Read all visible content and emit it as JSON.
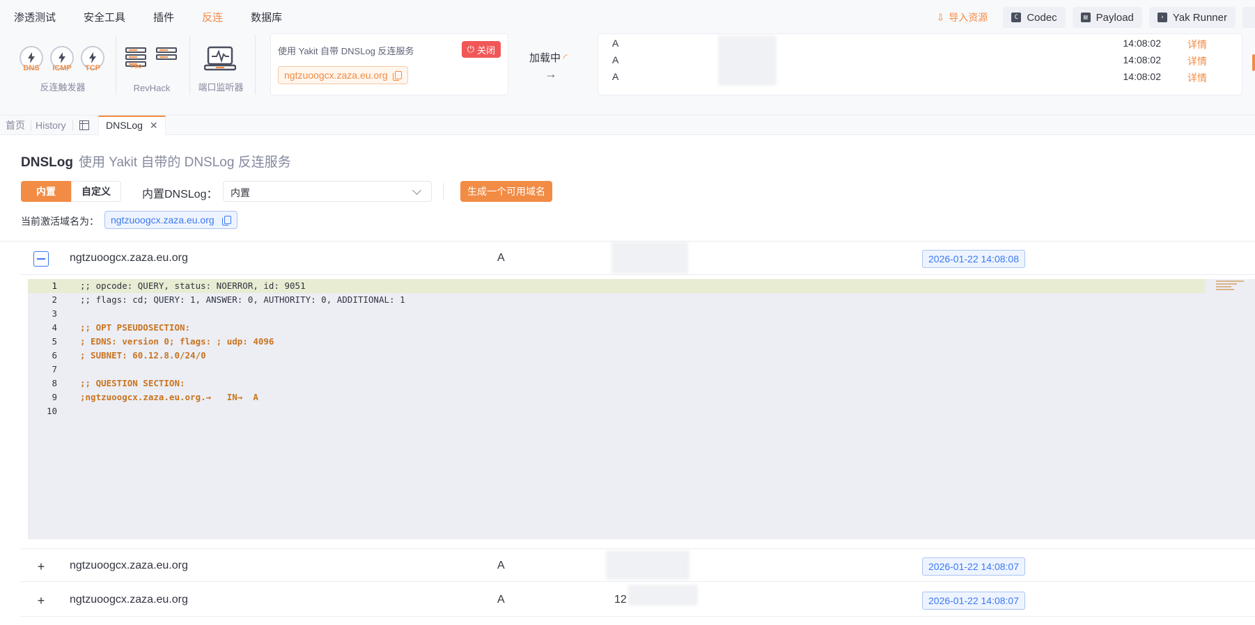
{
  "menu": [
    {
      "label": "渗透测试",
      "active": false
    },
    {
      "label": "安全工具",
      "active": false
    },
    {
      "label": "插件",
      "active": false
    },
    {
      "label": "反连",
      "active": true
    },
    {
      "label": "数据库",
      "active": false
    }
  ],
  "toolbar": {
    "import_label": "导入资源",
    "codec_label": "Codec",
    "payload_label": "Payload",
    "yak_runner_label": "Yak Runner"
  },
  "triggers": {
    "dns": "DNS",
    "icmp": "ICMP",
    "tcp": "TCP",
    "section_label": "反连触发器"
  },
  "revhack": {
    "yso": "Yso",
    "section_label": "RevHack"
  },
  "port_listener": {
    "section_label": "端口监听器"
  },
  "dns_card": {
    "title": "使用 Yakit 自带 DNSLog 反连服务",
    "close_label": "关闭",
    "domain": "ngtzuoogcx.zaza.eu.org"
  },
  "loading_label": "加载中",
  "recent_records": [
    {
      "type": "A",
      "time": "14:08:02",
      "detail": "详情"
    },
    {
      "type": "A",
      "time": "14:08:02",
      "detail": "详情"
    },
    {
      "type": "A",
      "time": "14:08:02",
      "detail": "详情"
    }
  ],
  "tabs": {
    "home": "首页",
    "history": "History",
    "dnslog": "DNSLog"
  },
  "page": {
    "title": "DNSLog",
    "subtitle": "使用 Yakit 自带的 DNSLog 反连服务",
    "mode_builtin": "内置",
    "mode_custom": "自定义",
    "select_label": "内置DNSLog",
    "select_value": "内置",
    "generate_label": "生成一个可用域名",
    "current_label": "当前激活域名为",
    "current_domain": "ngtzuoogcx.zaza.eu.org"
  },
  "records": [
    {
      "domain": "ngtzuoogcx.zaza.eu.org",
      "type": "A",
      "ip": "",
      "timestamp": "2026-01-22 14:08:08",
      "expanded": true
    },
    {
      "domain": "ngtzuoogcx.zaza.eu.org",
      "type": "A",
      "ip": "",
      "timestamp": "2026-01-22 14:08:07",
      "expanded": false
    },
    {
      "domain": "ngtzuoogcx.zaza.eu.org",
      "type": "A",
      "ip": "12",
      "timestamp": "2026-01-22 14:08:07",
      "expanded": false
    }
  ],
  "editor": {
    "lines": [
      {
        "n": "1",
        "text": ";; opcode: QUERY, status: NOERROR, id: 9051"
      },
      {
        "n": "2",
        "text": ";; flags: cd; QUERY: 1, ANSWER: 0, AUTHORITY: 0, ADDITIONAL: 1"
      },
      {
        "n": "3",
        "text": ""
      },
      {
        "n": "4",
        "text": ";; OPT PSEUDOSECTION:"
      },
      {
        "n": "5",
        "text": "; EDNS: version 0; flags: ; udp: 4096"
      },
      {
        "n": "6",
        "text": "; SUBNET: 60.12.8.0/24/0"
      },
      {
        "n": "7",
        "text": ""
      },
      {
        "n": "8",
        "text": ";; QUESTION SECTION:"
      },
      {
        "n": "9",
        "text": ";ngtzuoogcx.zaza.eu.org.→   IN→  A"
      },
      {
        "n": "10",
        "text": ""
      }
    ]
  },
  "colors": {
    "accent": "#f28b44",
    "link_blue": "#3a78f2",
    "danger": "#f15757"
  }
}
